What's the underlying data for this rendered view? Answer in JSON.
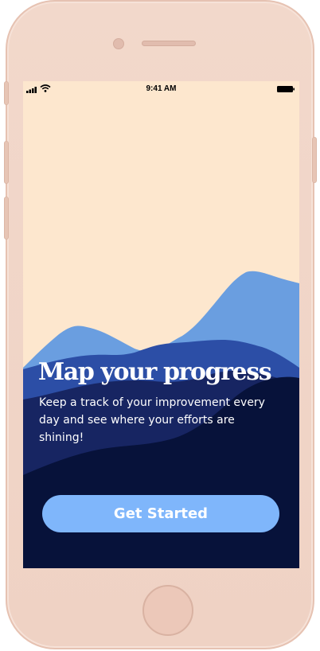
{
  "status_bar": {
    "time": "9:41 AM"
  },
  "onboarding": {
    "title": "Map your progress",
    "subtitle": "Keep a track of your improvement every day and see where your efforts are shining!",
    "cta_label": "Get Started"
  },
  "colors": {
    "screen_background": "#fde7ce",
    "mountain_light": "#6a9ee0",
    "mountain_mid": "#2c4ea6",
    "mountain_dark": "#172562",
    "mountain_darkest": "#07123a",
    "button": "#7fb6fb",
    "phone_body": "#f2d8cb"
  },
  "icons": {
    "signal": "signal-icon",
    "wifi": "wifi-icon",
    "battery": "battery-icon"
  }
}
